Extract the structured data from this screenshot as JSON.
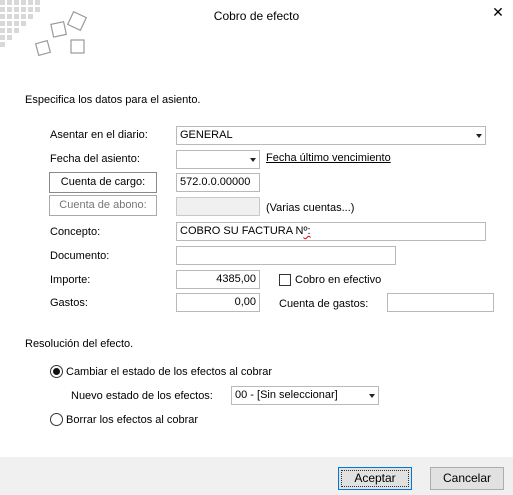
{
  "window": {
    "title": "Cobro de efecto",
    "close_glyph": "✕"
  },
  "intro": "Especifica los datos para el asiento.",
  "form": {
    "diario_label": "Asentar en el diario:",
    "diario_value": "GENERAL",
    "fecha_label": "Fecha del asiento:",
    "fecha_value": "",
    "fecha_link": "Fecha último vencimiento",
    "cargo_button": "Cuenta de cargo:",
    "cargo_value": "572.0.0.00000",
    "abono_button": "Cuenta de abono:",
    "abono_value": "",
    "varias_label": "(Varias cuentas...)",
    "concepto_label": "Concepto:",
    "concepto_value_main": "COBRO SU FACTURA N",
    "concepto_value_mark": "º:",
    "documento_label": "Documento:",
    "documento_value": "",
    "importe_label": "Importe:",
    "importe_value": "4385,00",
    "cobro_efectivo_label": "Cobro en efectivo",
    "cobro_efectivo_checked": false,
    "gastos_label": "Gastos:",
    "gastos_value": "0,00",
    "cuenta_gastos_label": "Cuenta de gastos:",
    "cuenta_gastos_value": ""
  },
  "resolucion": {
    "heading": "Resolución del efecto.",
    "option_cambiar": "Cambiar el estado de los efectos al cobrar",
    "nuevo_estado_label": "Nuevo estado de los efectos:",
    "nuevo_estado_value": "00 - [Sin seleccionar]",
    "option_borrar": "Borrar los efectos al cobrar",
    "selected": "cambiar"
  },
  "footer": {
    "accept_label": "Aceptar",
    "cancel_label": "Cancelar"
  }
}
